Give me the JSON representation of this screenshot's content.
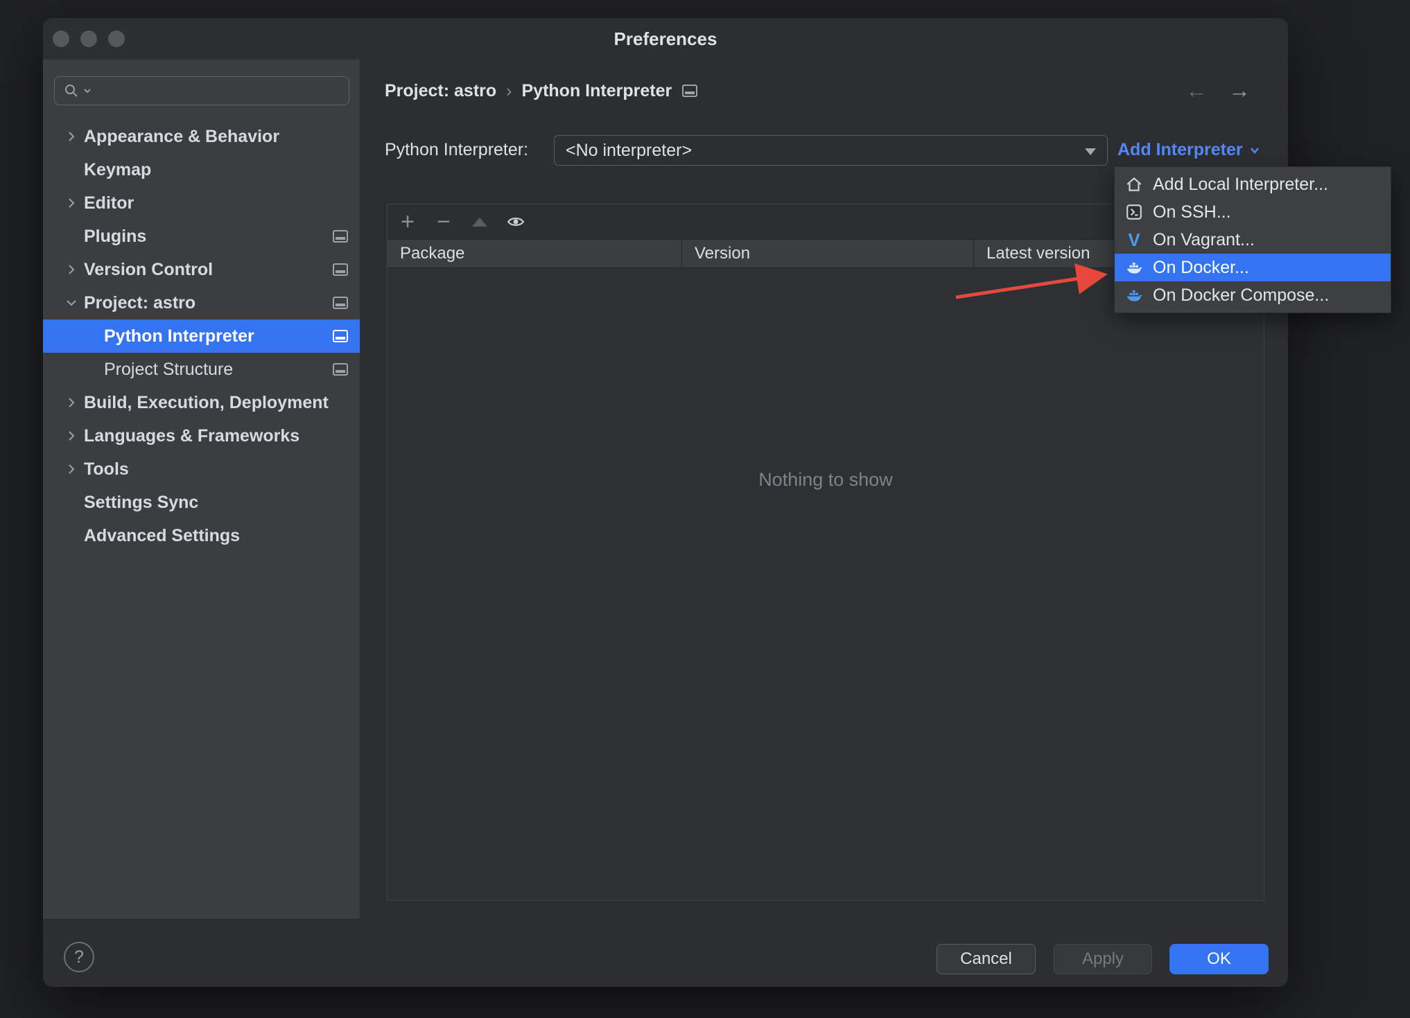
{
  "window": {
    "title": "Preferences"
  },
  "sidebar": {
    "items": [
      {
        "label": "Appearance & Behavior"
      },
      {
        "label": "Keymap"
      },
      {
        "label": "Editor"
      },
      {
        "label": "Plugins"
      },
      {
        "label": "Version Control"
      },
      {
        "label": "Project: astro"
      },
      {
        "label": "Python Interpreter",
        "selected": true
      },
      {
        "label": "Project Structure"
      },
      {
        "label": "Build, Execution, Deployment"
      },
      {
        "label": "Languages & Frameworks"
      },
      {
        "label": "Tools"
      },
      {
        "label": "Settings Sync"
      },
      {
        "label": "Advanced Settings"
      }
    ]
  },
  "breadcrumb": {
    "project": "Project: astro",
    "separator": "›",
    "page": "Python Interpreter"
  },
  "nav": {
    "back": "←",
    "forward": "→"
  },
  "interpreter": {
    "label": "Python Interpreter:",
    "value": "<No interpreter>",
    "add_link": "Add Interpreter"
  },
  "menu": {
    "items": [
      {
        "label": "Add Local Interpreter...",
        "icon": "home-icon"
      },
      {
        "label": "On SSH...",
        "icon": "ssh-icon"
      },
      {
        "label": "On Vagrant...",
        "icon": "vagrant-icon",
        "glyph": "V"
      },
      {
        "label": "On Docker...",
        "icon": "docker-icon",
        "selected": true
      },
      {
        "label": "On Docker Compose...",
        "icon": "docker-compose-icon"
      }
    ]
  },
  "toolbar": {
    "add": "+",
    "remove": "−",
    "icons": [
      "add-icon",
      "remove-icon",
      "move-up-icon",
      "show-early-releases-icon"
    ]
  },
  "table": {
    "columns": [
      "Package",
      "Version",
      "Latest version"
    ],
    "empty_text": "Nothing to show"
  },
  "footer": {
    "help": "?",
    "cancel": "Cancel",
    "apply": "Apply",
    "ok": "OK"
  },
  "colors": {
    "accent": "#3574f0",
    "link": "#548af7",
    "sidebar_selection": "#3574f0",
    "annotation_arrow": "#e8473b"
  }
}
